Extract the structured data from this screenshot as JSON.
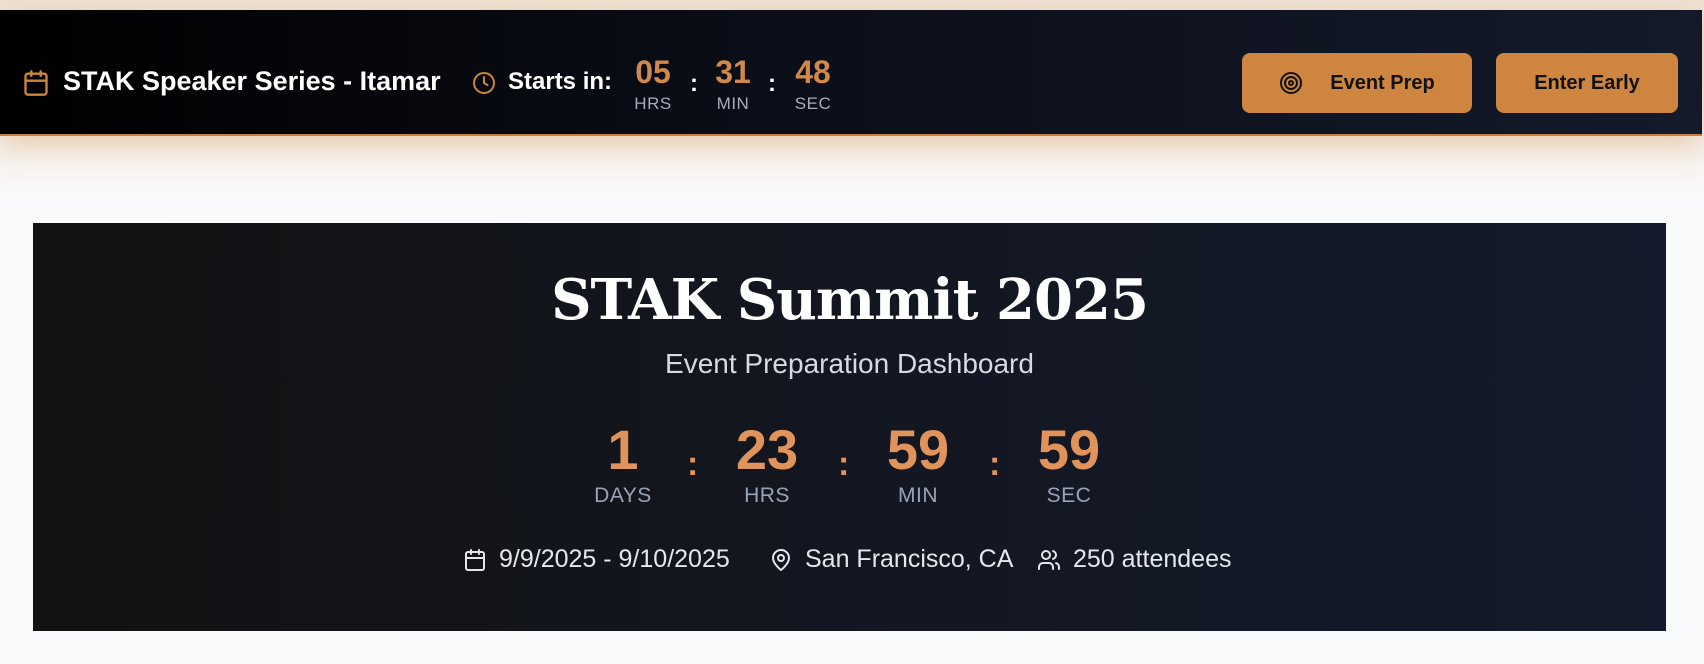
{
  "colors": {
    "accent": "#cd853f",
    "countdown": "#e0935a",
    "topbar_bg": "#0b0e18",
    "hero_bg": "#131722"
  },
  "topbar": {
    "title": "STAK Speaker Series - Itamar",
    "title_icon": "calendar-icon",
    "starts_icon": "clock-icon",
    "starts_label": "Starts in:",
    "countdown": {
      "hours": "05",
      "hours_label": "HRS",
      "minutes": "31",
      "minutes_label": "MIN",
      "seconds": "48",
      "seconds_label": "SEC",
      "separator": ":"
    },
    "buttons": {
      "event_prep": "Event Prep",
      "event_prep_icon": "target-icon",
      "enter_early": "Enter Early"
    }
  },
  "hero": {
    "title": "STAK Summit 2025",
    "subtitle": "Event Preparation Dashboard",
    "countdown": {
      "days": "1",
      "days_label": "DAYS",
      "hours": "23",
      "hours_label": "HRS",
      "minutes": "59",
      "minutes_label": "MIN",
      "seconds": "59",
      "seconds_label": "SEC",
      "separator": ":"
    },
    "details": {
      "dates": "9/9/2025 - 9/10/2025",
      "dates_icon": "calendar-icon",
      "location": "San Francisco, CA",
      "location_icon": "map-pin-icon",
      "attendees": "250 attendees",
      "attendees_icon": "users-icon"
    }
  }
}
